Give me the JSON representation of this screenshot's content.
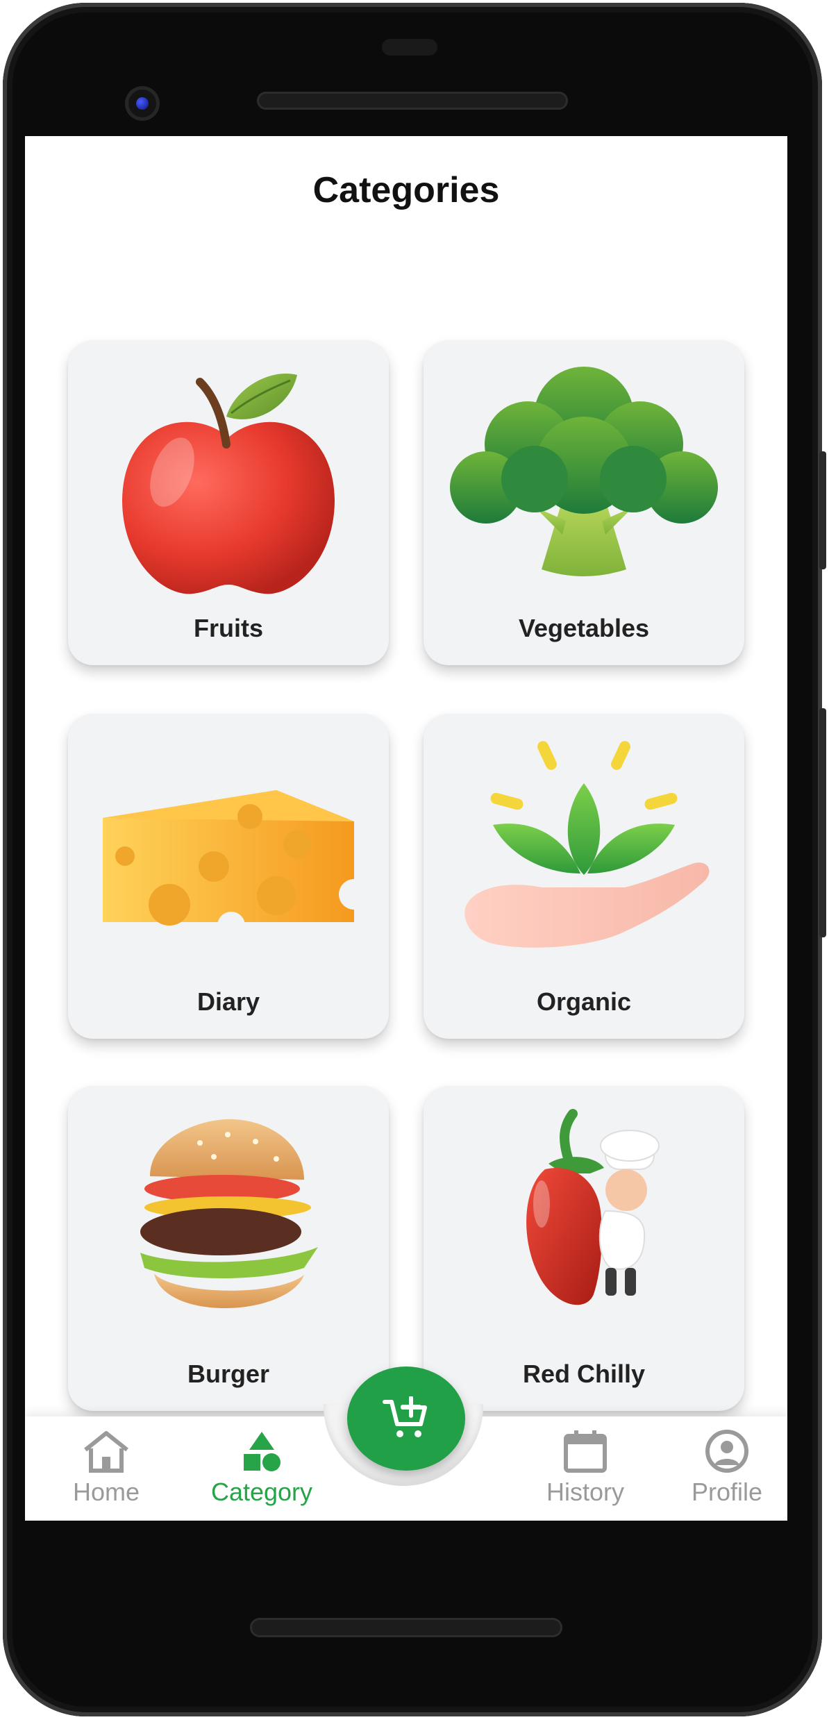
{
  "page": {
    "title": "Categories"
  },
  "categories": [
    {
      "label": "Fruits",
      "icon": "apple-icon"
    },
    {
      "label": "Vegetables",
      "icon": "broccoli-icon"
    },
    {
      "label": "Diary",
      "icon": "cheese-icon"
    },
    {
      "label": "Organic",
      "icon": "plant-in-hand-icon"
    },
    {
      "label": "Burger",
      "icon": "burger-icon"
    },
    {
      "label": "Red Chilly",
      "icon": "chilli-chef-icon"
    }
  ],
  "nav": {
    "items": [
      {
        "label": "Home",
        "icon": "home-icon"
      },
      {
        "label": "Category",
        "icon": "shapes-icon",
        "active": true
      },
      {
        "label": "History",
        "icon": "calendar-icon"
      },
      {
        "label": "Profile",
        "icon": "profile-icon"
      }
    ],
    "fab_icon": "add-to-cart-icon"
  },
  "colors": {
    "accent": "#22a047",
    "card_bg": "#f2f3f5",
    "inactive": "#9a9a9a"
  }
}
